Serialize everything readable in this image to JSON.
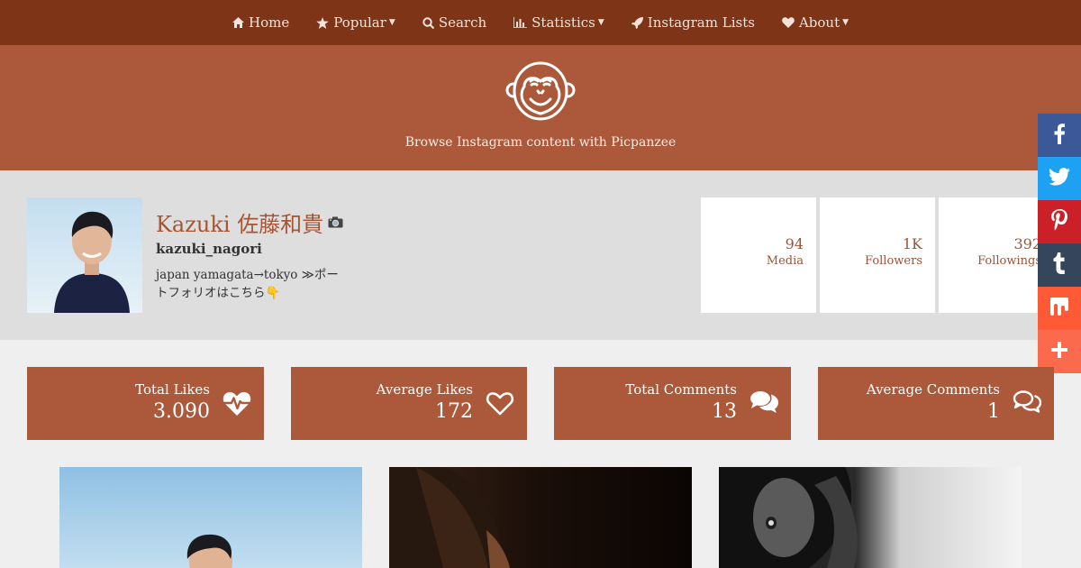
{
  "nav": {
    "items": [
      {
        "label": "Home",
        "icon": "home-icon",
        "dropdown": false
      },
      {
        "label": "Popular",
        "icon": "star-icon",
        "dropdown": true
      },
      {
        "label": "Search",
        "icon": "search-icon",
        "dropdown": false
      },
      {
        "label": "Statistics",
        "icon": "bar-chart-icon",
        "dropdown": true
      },
      {
        "label": "Instagram Lists",
        "icon": "rocket-icon",
        "dropdown": false
      },
      {
        "label": "About",
        "icon": "heart-icon",
        "dropdown": true
      }
    ]
  },
  "hero": {
    "logo_icon": "monkey-logo-icon",
    "tagline": "Browse Instagram content with Picpanzee"
  },
  "profile": {
    "name": "Kazuki 佐藤和貴",
    "username": "kazuki_nagori",
    "bio_line1": "japan yamagata→tokyo ≫ポー",
    "bio_line2": "トフォリオはこちら",
    "bio_emoji": "👇",
    "stats": [
      {
        "value": "94",
        "label": "Media"
      },
      {
        "value": "1K",
        "label": "Followers"
      },
      {
        "value": "392",
        "label": "Followings"
      }
    ]
  },
  "share": [
    {
      "name": "facebook",
      "glyph": "f",
      "color": "#3b5998"
    },
    {
      "name": "twitter",
      "glyph": "t",
      "color": "#1da1f2"
    },
    {
      "name": "pinterest",
      "glyph": "P",
      "color": "#cb2027"
    },
    {
      "name": "tumblr",
      "glyph": "t",
      "color": "#35465c"
    },
    {
      "name": "mix",
      "glyph": "m",
      "color": "#ff5a36"
    },
    {
      "name": "more",
      "glyph": "+",
      "color": "#fc6a4e"
    }
  ],
  "summary": [
    {
      "title": "Total Likes",
      "value": "3.090",
      "icon": "heartbeat-icon"
    },
    {
      "title": "Average Likes",
      "value": "172",
      "icon": "heart-outline-icon"
    },
    {
      "title": "Total Comments",
      "value": "13",
      "icon": "comments-icon"
    },
    {
      "title": "Average Comments",
      "value": "1",
      "icon": "comments-outline-icon"
    }
  ],
  "colors": {
    "nav_bg": "#7e3417",
    "hero_bg": "#ab593a",
    "card_bg": "#ab593a",
    "profile_bg": "#dedede"
  }
}
